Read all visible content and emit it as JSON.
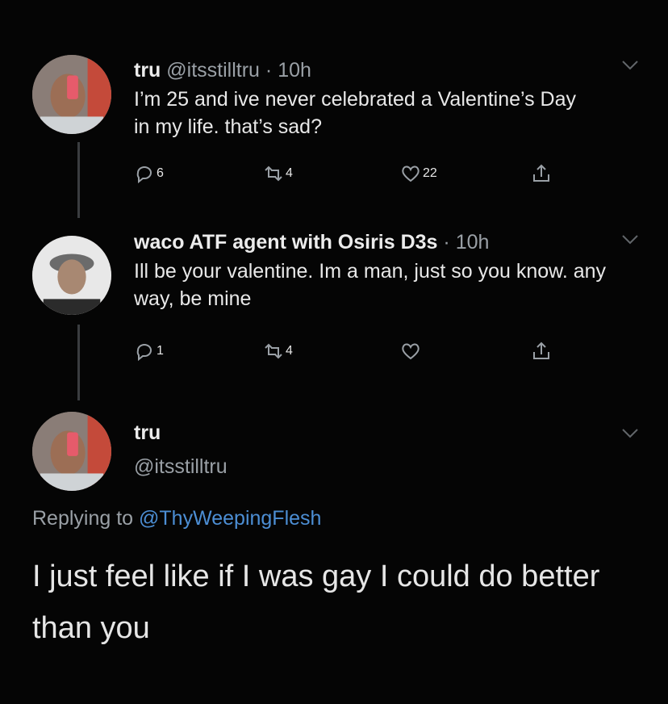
{
  "tweets": [
    {
      "name": "tru",
      "handle": "@itsstilltru",
      "sep": "·",
      "time": "10h",
      "text": "I’m 25 and ive never celebrated a Valentine’s Day in my life. that’s sad?",
      "reply_count": "6",
      "retweet_count": "4",
      "like_count": "22"
    },
    {
      "name": "waco ATF agent with Osiris D3s",
      "sep": "·",
      "time": "10h",
      "text": "Ill be your valentine. Im a man, just so you know. any way, be mine",
      "reply_count": "1",
      "retweet_count": "4",
      "like_count": ""
    }
  ],
  "focused": {
    "name": "tru",
    "handle": "@itsstilltru",
    "replying_prefix": "Replying to",
    "replying_mention": "@ThyWeepingFlesh",
    "text": "I just feel like if I was gay I could do better than you"
  },
  "icons": {
    "reply": "reply-icon",
    "retweet": "retweet-icon",
    "like": "heart-icon",
    "share": "share-icon",
    "more": "chevron-down-icon"
  },
  "colors": {
    "background": "#050505",
    "text": "#e7e7e7",
    "muted": "#9aa0a6",
    "mention": "#4c8ed4",
    "thread_line": "#3a3d40"
  }
}
